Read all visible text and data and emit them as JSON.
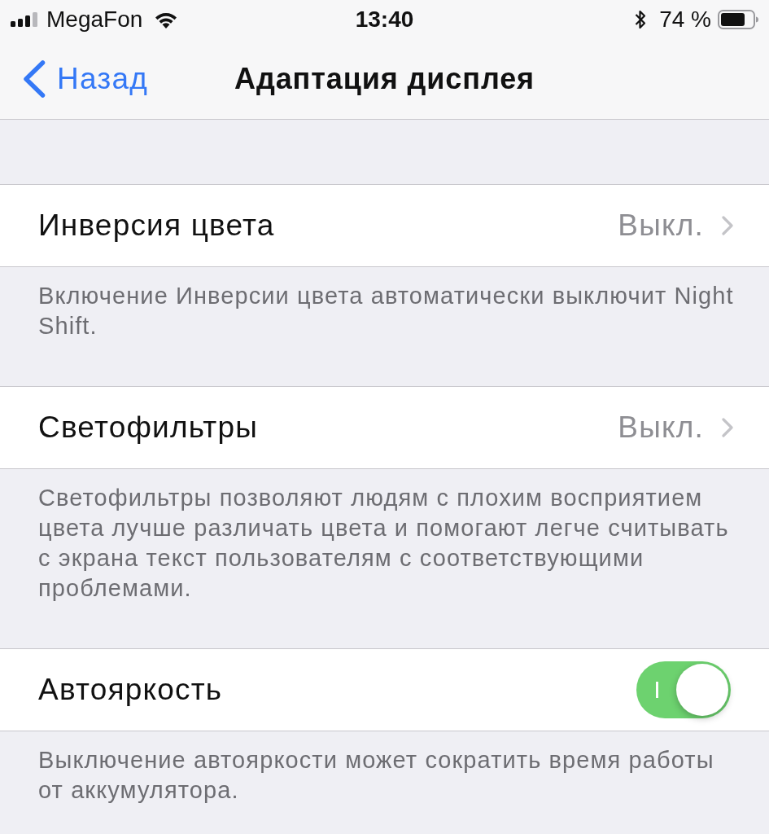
{
  "status_bar": {
    "carrier": "MegaFon",
    "time": "13:40",
    "battery_percent": "74 %"
  },
  "nav_bar": {
    "back_label": "Назад",
    "title": "Адаптация дисплея"
  },
  "groups": [
    {
      "row": {
        "kind": "disclosure",
        "label": "Инверсия цвета",
        "value": "Выкл."
      },
      "footer": "Включение Инверсии цвета автоматически выключит Night Shift."
    },
    {
      "row": {
        "kind": "disclosure",
        "label": "Светофильтры",
        "value": "Выкл."
      },
      "footer": "Светофильтры позволяют людям с плохим восприятием цвета лучше различать цвета и помогают легче считывать с экрана текст пользователям с соответствующими проблемами."
    },
    {
      "row": {
        "kind": "switch",
        "label": "Автояркость",
        "on": true
      },
      "footer": "Выключение автояркости может сократить время работы от аккумулятора."
    }
  ]
}
